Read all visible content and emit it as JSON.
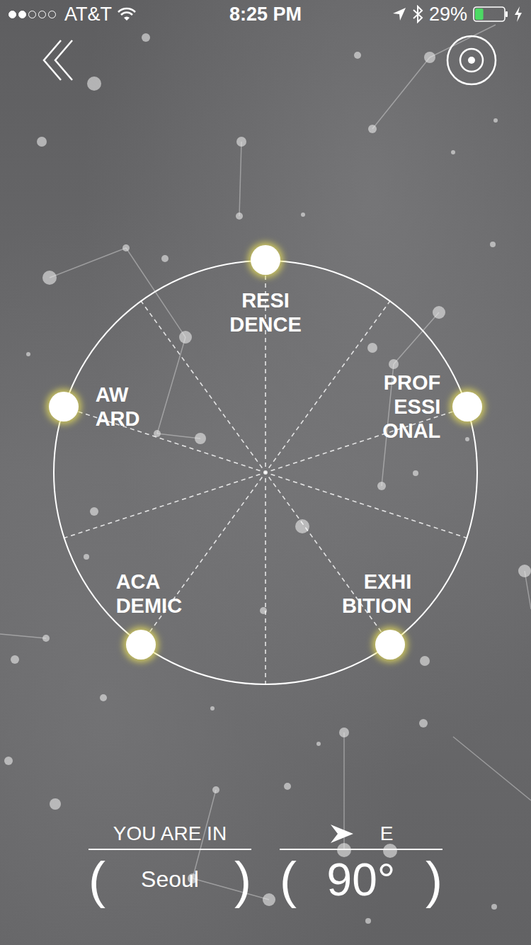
{
  "status_bar": {
    "carrier": "AT&T",
    "signal": {
      "level": 0.4
    },
    "time": "8:25 PM",
    "battery": {
      "reading": "29%",
      "level": 0.29,
      "charging": true
    }
  },
  "categories": [
    {
      "lines": [
        "RESI",
        "DENCE"
      ]
    },
    {
      "lines": [
        "PROF",
        "ESSI",
        "ONAL"
      ]
    },
    {
      "lines": [
        "EXHI",
        "BITION"
      ]
    },
    {
      "lines": [
        "ACA",
        "DEMIC"
      ]
    },
    {
      "lines": [
        "AW",
        "ARD"
      ]
    }
  ],
  "location": {
    "label": "YOU ARE IN",
    "open": "(",
    "value": "Seoul",
    "close": ")"
  },
  "heading": {
    "direction": "E",
    "open": "(",
    "value": "90°",
    "close": ")"
  }
}
